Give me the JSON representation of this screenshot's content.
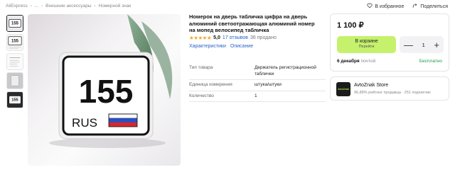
{
  "breadcrumb": {
    "items": [
      "AliExpress",
      "...",
      "Внешние аксессуары",
      "Номерной знак"
    ]
  },
  "actions": {
    "favorites_label": "В избранное",
    "share_label": "Поделиться"
  },
  "gallery": {
    "plate_number": "155",
    "plate_region": "RUS",
    "thumb_labels": [
      "155",
      "155",
      "",
      "",
      "155"
    ]
  },
  "product": {
    "title": "Номерок на дверь табличка цифра на дверь алюминий светоотражающая алюминий номер на мопед велосипед табличка",
    "stars": "★★★★★",
    "rating": "5,0",
    "reviews": "17 отзывов",
    "sold": "36 продано",
    "tabs": [
      "Характеристики",
      "Описание"
    ]
  },
  "specs": [
    {
      "key": "Тип товара",
      "value": "Держатель регистрационной таблички"
    },
    {
      "key": "Единица измерения",
      "value": "штука/штуки"
    },
    {
      "key": "Количество",
      "value": "1"
    }
  ],
  "purchase": {
    "price": "1 100 ₽",
    "cart_label": "В корзине",
    "cart_sublabel": "Перейти",
    "quantity": "1",
    "minus": "—",
    "plus": "+",
    "delivery_date": "6 декабря",
    "delivery_carrier": "почтой",
    "delivery_price": "Бесплатно"
  },
  "store": {
    "logo_text": "AvtoZnak",
    "name": "AvtoZnak Store",
    "meta": "96,88% рейтинг продавца · 251 подписчик"
  },
  "colors": {
    "accent_green": "#c5f16c",
    "link_blue": "#2a63c9",
    "free_green": "#1a9d48",
    "star": "#f5a623"
  }
}
